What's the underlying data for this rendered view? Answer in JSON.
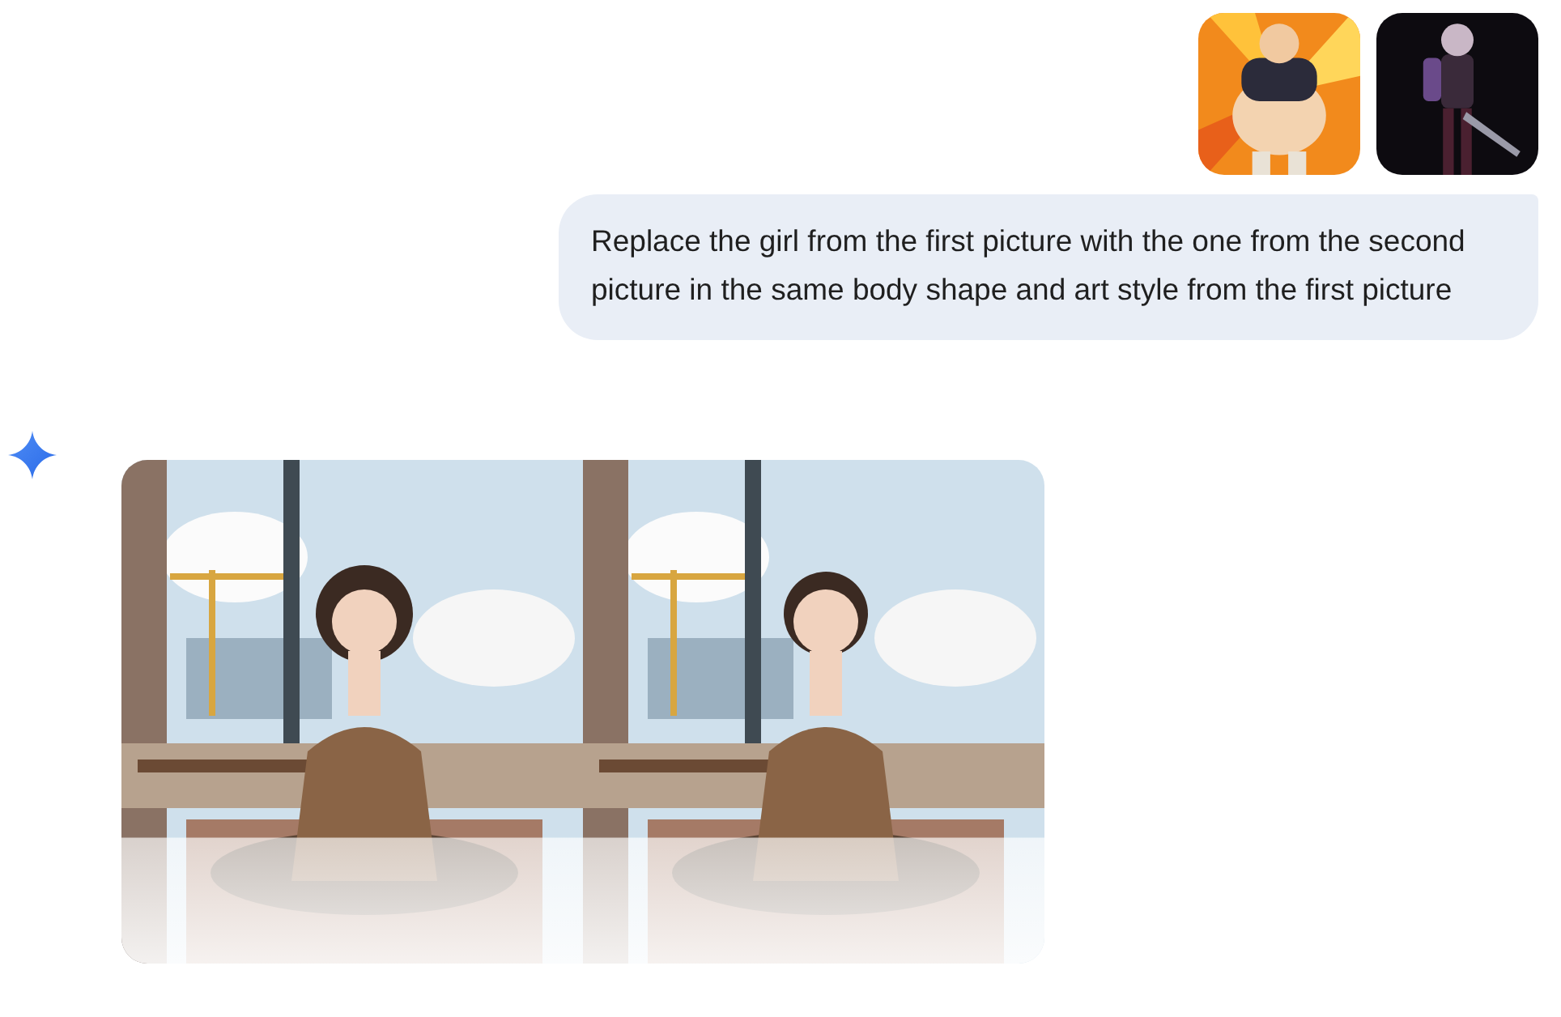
{
  "user_message": {
    "text": "Replace the girl from the first picture with the one from the second picture in the same body shape and art style from the first picture"
  }
}
